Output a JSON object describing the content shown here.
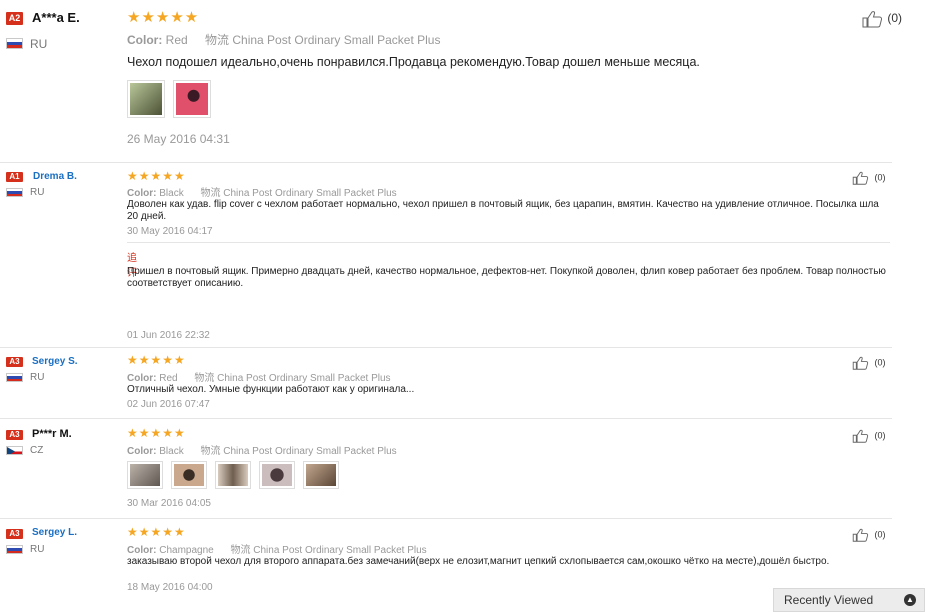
{
  "reviews": [
    {
      "badge": "A2",
      "name": "A***a E.",
      "country": "RU",
      "stars": "★★★★★",
      "color_label": "Color:",
      "color_value": "Red",
      "shipping": "物流 China Post Ordinary Small Packet Plus",
      "text": "Чехол подошел идеально,очень понравился.Продавца рекомендую.Товар дошел меньше месяца.",
      "date": "26 May 2016 04:31",
      "likes": "(0)",
      "photos": [
        "#6b6f45",
        "#e0506a"
      ]
    },
    {
      "badge": "A1",
      "name": "Drema B.",
      "country": "RU",
      "stars": "★★★★★",
      "color_label": "Color:",
      "color_value": "Black",
      "shipping": "物流 China Post Ordinary Small Packet Plus",
      "text": "Доволен как удав. flip cover с чехлом работает нормально, чехол пришел в почтовый ящик, без царапин, вмятин. Качество на удивление отличное. Посылка шла 20 дней.",
      "date": "30 May 2016 04:17",
      "likes": "(0)",
      "additional_label": "追评",
      "additional_text": "Пришел в почтовый ящик. Примерно двадцать дней, качество нормальное, дефектов-нет. Покупкой доволен, флип ковер работает без проблем. Товар полностью соответствует описанию.",
      "additional_date": "01 Jun 2016 22:32"
    },
    {
      "badge": "A3",
      "name": "Sergey S.",
      "country": "RU",
      "stars": "★★★★★",
      "color_label": "Color:",
      "color_value": "Red",
      "shipping": "物流 China Post Ordinary Small Packet Plus",
      "text": "Отличный чехол. Умные функции работают как у оригинала...",
      "date": "02 Jun 2016 07:47",
      "likes": "(0)"
    },
    {
      "badge": "A3",
      "name": "P***r M.",
      "country": "CZ",
      "stars": "★★★★★",
      "color_label": "Color:",
      "color_value": "Black",
      "shipping": "物流 China Post Ordinary Small Packet Plus",
      "date": "30 Mar 2016 04:05",
      "likes": "(0)",
      "photos": [
        "#7d746c",
        "#8a6a58",
        "#9a8a7a",
        "#7a6a6e",
        "#8e7460"
      ]
    },
    {
      "badge": "A3",
      "name": "Sergey L.",
      "country": "RU",
      "stars": "★★★★★",
      "color_label": "Color:",
      "color_value": "Champagne",
      "shipping": "物流 China Post Ordinary Small Packet Plus",
      "text": "заказываю второй чехол для второго аппарата.без замечаний(верх не елозит,магнит цепкий схлопывается сам,окошко чётко на месте),дошёл быстро.",
      "date": "18 May 2016 04:00",
      "likes": "(0)"
    }
  ],
  "recently_viewed": "Recently Viewed",
  "colors": {
    "badge": "#d5301b",
    "star": "#f5a623",
    "link_name": "#1a6fc2"
  }
}
